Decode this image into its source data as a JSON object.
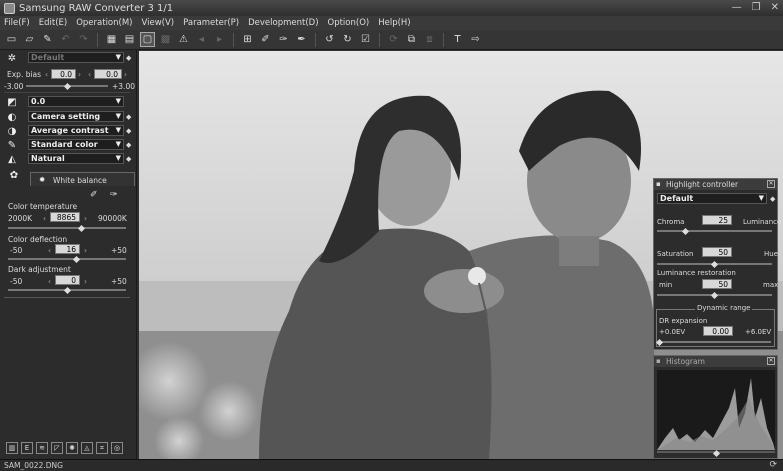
{
  "window": {
    "title": "Samsung RAW Converter 3  1/1"
  },
  "menu": [
    "File(F)",
    "Edit(E)",
    "Operation(M)",
    "View(V)",
    "Parameter(P)",
    "Development(D)",
    "Option(O)",
    "Help(H)"
  ],
  "left": {
    "preset": "Default",
    "exp_bias_label": "Exp. bias",
    "exp_min": "-3.00",
    "exp_max": "+3.00",
    "exp_val1": "0.0",
    "exp_val2": "0.0",
    "exp_level": 0.5,
    "curve_value": "0.0",
    "camera_setting": "Camera setting",
    "contrast": "Average contrast",
    "color": "Standard color",
    "sharp": "Natural",
    "wb_tab": "White balance",
    "color_temp_label": "Color temperature",
    "color_temp_min": "2000K",
    "color_temp_max": "90000K",
    "color_temp_val": "8865",
    "color_temp_level": 0.62,
    "color_dev_label": "Color deflection",
    "color_dev_min": "-50",
    "color_dev_max": "+50",
    "color_dev_val": "16",
    "color_dev_level": 0.58,
    "dark_label": "Dark adjustment",
    "dark_min": "-50",
    "dark_max": "+50",
    "dark_val": "0",
    "dark_level": 0.5
  },
  "highlight": {
    "title": "Highlight controller",
    "preset": "Default",
    "chroma": "Chroma",
    "luminance": "Luminance",
    "chroma_val": "25",
    "chroma_level": 0.25,
    "saturation": "Saturation",
    "hue": "Hue",
    "saturation_val": "50",
    "saturation_level": 0.5,
    "lum_rest": "Luminance restoration",
    "min": "min",
    "max": "max",
    "lum_val": "50",
    "lum_level": 0.5,
    "dynamic_range": "Dynamic range",
    "dr_expansion": "DR expansion",
    "dr_min": "+0.0EV",
    "dr_max": "+6.0EV",
    "dr_val": "0.00",
    "dr_level": 0.0
  },
  "histogram": {
    "title": "Histogram"
  },
  "status": {
    "file": "SAM_0022.DNG"
  }
}
